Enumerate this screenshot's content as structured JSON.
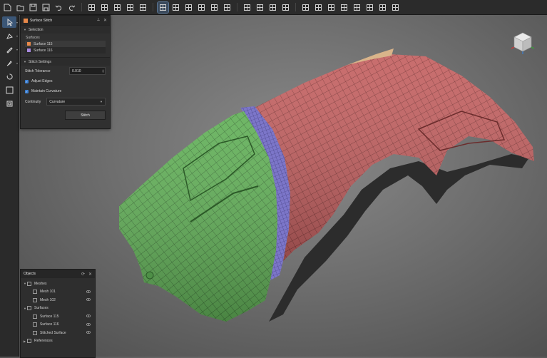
{
  "panel": {
    "title": "Surface Stitch",
    "selection_section": "Selection",
    "surfaces_label": "Surfaces",
    "surfaces": [
      {
        "name": "Surface 115",
        "color": "#e8894a"
      },
      {
        "name": "Surface 116",
        "color": "#a98ae0"
      }
    ],
    "settings_section": "Stitch Settings",
    "tolerance_label": "Stitch Tolerance",
    "tolerance_value": "0.010",
    "adjust_edges_label": "Adjust Edges",
    "adjust_edges_checked": true,
    "maintain_curvature_label": "Maintain Curvature",
    "maintain_curvature_checked": true,
    "continuity_label": "Continuity",
    "continuity_value": "Curvature",
    "stitch_button": "Stitch"
  },
  "objects": {
    "title": "Objects",
    "tree": [
      {
        "label": "Meshes",
        "level": 0,
        "expanded": true
      },
      {
        "label": "Mesh 101",
        "level": 1
      },
      {
        "label": "Mesh 102",
        "level": 1
      },
      {
        "label": "Surfaces",
        "level": 0,
        "expanded": true
      },
      {
        "label": "Surface 115",
        "level": 1
      },
      {
        "label": "Surface 116",
        "level": 1
      },
      {
        "label": "Stitched Surface",
        "level": 1
      },
      {
        "label": "References",
        "level": 0,
        "expanded": false
      }
    ]
  },
  "colors": {
    "accent": "#3b7fd4",
    "mesh_green": "#5fae55",
    "mesh_red": "#c26060",
    "stitch_purple": "#7b74c8"
  },
  "toolbar_icons": [
    "new-file-icon",
    "open-folder-icon",
    "save-icon",
    "save-as-icon",
    "undo-icon",
    "redo-icon",
    "transform-icon",
    "align-icon",
    "mesh-select-icon",
    "mesh-box-icon",
    "mesh-lasso-icon",
    "select-box-icon",
    "scale-icon",
    "grid-icon",
    "subdivide-icon",
    "mirror-icon",
    "repair-icon",
    "fill-icon",
    "smooth-icon",
    "region-icon",
    "inspect-icon",
    "measure-icon",
    "section-icon",
    "deviation-icon",
    "fit-icon",
    "move-icon",
    "brush-icon",
    "eraser-icon",
    "render-icon"
  ],
  "left_tools": [
    "select-arrow-icon",
    "pick-surface-icon",
    "pen-tool-icon",
    "brush-tool-icon",
    "rotate-tool-icon",
    "move-tool-icon",
    "stitch-tool-icon"
  ]
}
